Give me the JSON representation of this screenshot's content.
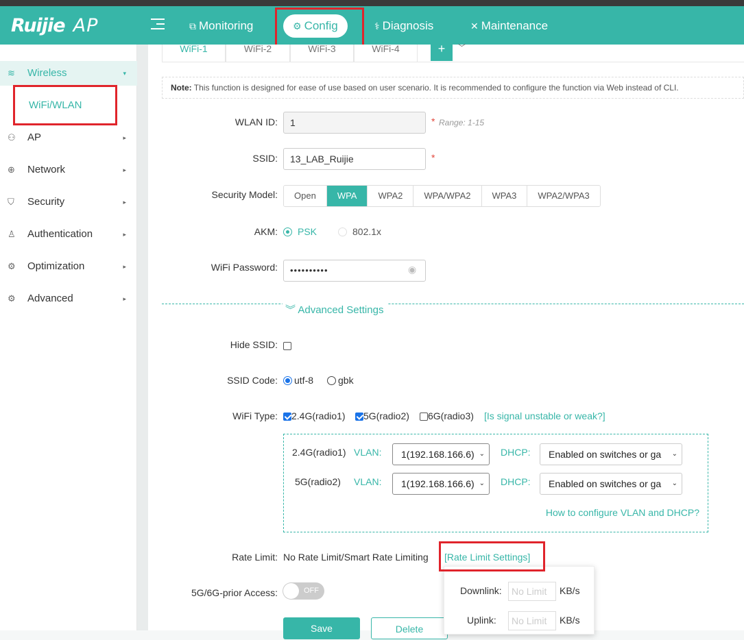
{
  "header": {
    "brand": "Ruijie",
    "product": "AP",
    "nav": [
      {
        "label": "Monitoring",
        "icon": "monitor-icon"
      },
      {
        "label": "Config",
        "icon": "gear-icon"
      },
      {
        "label": "Diagnosis",
        "icon": "stethoscope-icon"
      },
      {
        "label": "Maintenance",
        "icon": "tools-icon"
      }
    ]
  },
  "sidebar": {
    "items": [
      {
        "label": "Wireless",
        "icon": "wifi-icon"
      },
      {
        "label": "WiFi/WLAN"
      },
      {
        "label": "AP",
        "icon": "ap-icon"
      },
      {
        "label": "Network",
        "icon": "globe-icon"
      },
      {
        "label": "Security",
        "icon": "shield-icon"
      },
      {
        "label": "Authentication",
        "icon": "user-icon"
      },
      {
        "label": "Optimization",
        "icon": "tune-icon"
      },
      {
        "label": "Advanced",
        "icon": "gear-icon"
      }
    ]
  },
  "tabs": [
    "WiFi-1",
    "WiFi-2",
    "WiFi-3",
    "WiFi-4"
  ],
  "tab_add": "+",
  "note": {
    "prefix": "Note:",
    "text": "This function is designed for ease of use based on user scenario. It is recommended to configure the function via Web instead of CLI."
  },
  "form": {
    "wlan_id": {
      "label": "WLAN ID:",
      "value": "1",
      "hint": "Range: 1-15"
    },
    "ssid": {
      "label": "SSID:",
      "value": "13_LAB_Ruijie"
    },
    "required_mark": "*",
    "security": {
      "label": "Security Model:",
      "options": [
        "Open",
        "WPA",
        "WPA2",
        "WPA/WPA2",
        "WPA3",
        "WPA2/WPA3"
      ],
      "selected": "WPA"
    },
    "akm": {
      "label": "AKM:",
      "options": [
        "PSK",
        "802.1x"
      ],
      "selected": "PSK"
    },
    "password": {
      "label": "WiFi Password:",
      "value": "••••••••••"
    },
    "advanced_label": "Advanced Settings",
    "hide_ssid": {
      "label": "Hide SSID:",
      "checked": false
    },
    "ssid_code": {
      "label": "SSID Code:",
      "options": [
        "utf-8",
        "gbk"
      ],
      "selected": "utf-8"
    },
    "wifi_type": {
      "label": "WiFi Type:",
      "options": [
        "2.4G(radio1)",
        "5G(radio2)",
        "6G(radio3)"
      ],
      "checked": [
        true,
        true,
        false
      ],
      "help_link": "[Is signal unstable or weak?]"
    },
    "vlan_rows": [
      {
        "radio": "2.4G(radio1)",
        "vlan_label": "VLAN:",
        "vlan_value": "1(192.168.166.6)",
        "dhcp_label": "DHCP:",
        "dhcp_value": "Enabled on switches or ga"
      },
      {
        "radio": "5G(radio2)",
        "vlan_label": "VLAN:",
        "vlan_value": "1(192.168.166.6)",
        "dhcp_label": "DHCP:",
        "dhcp_value": "Enabled on switches or ga"
      }
    ],
    "vlan_help": "How to configure VLAN and DHCP?",
    "rate_limit": {
      "label": "Rate Limit:",
      "value": "No Rate Limit/Smart Rate Limiting",
      "link": "[Rate Limit Settings]"
    },
    "rate_popup": {
      "downlink_label": "Downlink:",
      "uplink_label": "Uplink:",
      "placeholder": "No Limit",
      "unit": "KB/s"
    },
    "prior_access": {
      "label": "5G/6G-prior Access:",
      "state": "OFF"
    },
    "save": "Save",
    "delete": "Delete"
  },
  "colors": {
    "accent": "#37b6a8",
    "highlight_box": "#e0242b",
    "required": "#e2463b"
  }
}
